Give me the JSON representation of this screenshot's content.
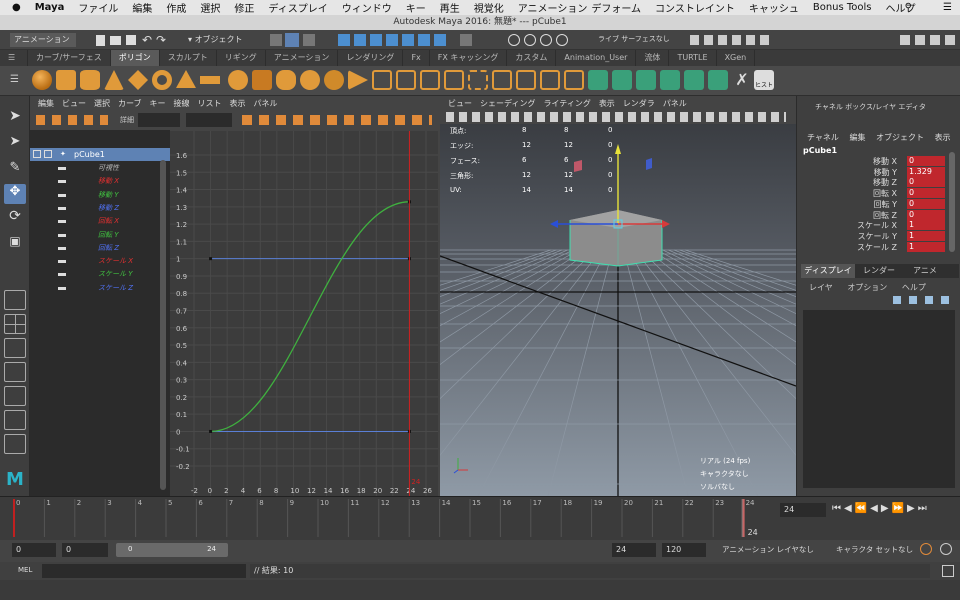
{
  "mac_menu": {
    "apple": "",
    "app": "Maya",
    "items": [
      "ファイル",
      "編集",
      "作成",
      "選択",
      "修正",
      "ディスプレイ",
      "ウィンドウ",
      "キー",
      "再生",
      "視覚化",
      "アニメーション",
      "デフォーム",
      "コンストレイント",
      "キャッシュ",
      "Bonus Tools",
      "ヘルプ"
    ]
  },
  "window_title": "Autodesk Maya 2016: 無題*   ---   pCube1",
  "status_line": {
    "menuset": "アニメーション",
    "select_mode": "オブジェクト",
    "live_surface": "ライブ サーフェスなし"
  },
  "shelf_tabs": [
    "カーブ/サーフェス",
    "ポリゴン",
    "スカルプト",
    "リギング",
    "アニメーション",
    "レンダリング",
    "Fx",
    "FX キャッシング",
    "カスタム",
    "Animation_User",
    "流体",
    "TURTLE",
    "XGen"
  ],
  "active_shelf_tab": "ポリゴン",
  "shelf_last_label": "ヒスト",
  "graph_editor": {
    "menu": [
      "編集",
      "ビュー",
      "選択",
      "カーブ",
      "キー",
      "接線",
      "リスト",
      "表示",
      "パネル"
    ],
    "detail_label": "詳細",
    "outliner_root": "pCube1",
    "channels": [
      {
        "label": "可視性",
        "color": "#bbbbbb"
      },
      {
        "label": "移動 X",
        "color": "#e03030"
      },
      {
        "label": "移動 Y",
        "color": "#40c040"
      },
      {
        "label": "移動 Z",
        "color": "#5070f0"
      },
      {
        "label": "回転 X",
        "color": "#e03030"
      },
      {
        "label": "回転 Y",
        "color": "#40c040"
      },
      {
        "label": "回転 Z",
        "color": "#5070f0"
      },
      {
        "label": "スケール X",
        "color": "#e03030"
      },
      {
        "label": "スケール Y",
        "color": "#40c040"
      },
      {
        "label": "スケール Z",
        "color": "#5070f0"
      }
    ],
    "y_ticks": [
      "1.6",
      "1.5",
      "1.4",
      "1.3",
      "1.2",
      "1.1",
      "1",
      "0.9",
      "0.8",
      "0.7",
      "0.6",
      "0.5",
      "0.4",
      "0.3",
      "0.2",
      "0.1",
      "0",
      "-0.1",
      "-0.2"
    ],
    "x_ticks": [
      "-2",
      "0",
      "2",
      "4",
      "6",
      "8",
      "10",
      "12",
      "14",
      "16",
      "18",
      "20",
      "22",
      "24",
      "26"
    ],
    "current_frame_tick": "24",
    "curve_translate_y": {
      "from_frame": 0,
      "to_frame": 24,
      "from_value": 0,
      "to_value": 1.329
    }
  },
  "viewport": {
    "menu": [
      "ビュー",
      "シェーディング",
      "ライティング",
      "表示",
      "レンダラ",
      "パネル"
    ],
    "hud_stats": [
      {
        "label": "頂点:",
        "c1": "8",
        "c2": "8",
        "c3": "0"
      },
      {
        "label": "エッジ:",
        "c1": "12",
        "c2": "12",
        "c3": "0"
      },
      {
        "label": "フェース:",
        "c1": "6",
        "c2": "6",
        "c3": "0"
      },
      {
        "label": "三角形:",
        "c1": "12",
        "c2": "12",
        "c3": "0"
      },
      {
        "label": "UV:",
        "c1": "14",
        "c2": "14",
        "c3": "0"
      }
    ],
    "hud_fps": "リアル (24 fps)",
    "hud_char": "キャラクタなし",
    "hud_solver": "ソルバなし"
  },
  "channel_box": {
    "title": "チャネル ボックス/レイヤ エディタ",
    "menu": [
      "チャネル",
      "編集",
      "オブジェクト",
      "表示"
    ],
    "object": "pCube1",
    "attrs": [
      {
        "label": "移動 X",
        "value": "0"
      },
      {
        "label": "移動 Y",
        "value": "1.329"
      },
      {
        "label": "移動 Z",
        "value": "0"
      },
      {
        "label": "回転 X",
        "value": "0"
      },
      {
        "label": "回転 Y",
        "value": "0"
      },
      {
        "label": "回転 Z",
        "value": "0"
      },
      {
        "label": "スケール X",
        "value": "1"
      },
      {
        "label": "スケール Y",
        "value": "1"
      },
      {
        "label": "スケール Z",
        "value": "1"
      }
    ],
    "layer_tabs": [
      "ディスプレイ",
      "レンダー",
      "アニメ"
    ],
    "layer_menu": [
      "レイヤ",
      "オプション",
      "ヘルプ"
    ]
  },
  "timeline": {
    "ticks": [
      "0",
      "1",
      "2",
      "3",
      "4",
      "5",
      "6",
      "7",
      "8",
      "9",
      "10",
      "11",
      "12",
      "13",
      "14",
      "15",
      "16",
      "17",
      "18",
      "19",
      "20",
      "21",
      "22",
      "23",
      "24"
    ],
    "current_frame": "24",
    "current_frame_field": "24"
  },
  "range": {
    "start": "0",
    "anim_start": "0",
    "slider_start": "0",
    "slider_end": "24",
    "anim_end": "24",
    "end": "120",
    "anim_layer": "アニメーション レイヤなし",
    "character_set": "キャラクタ セットなし"
  },
  "command_line": {
    "mode": "MEL",
    "result": "// 結果: 10"
  }
}
